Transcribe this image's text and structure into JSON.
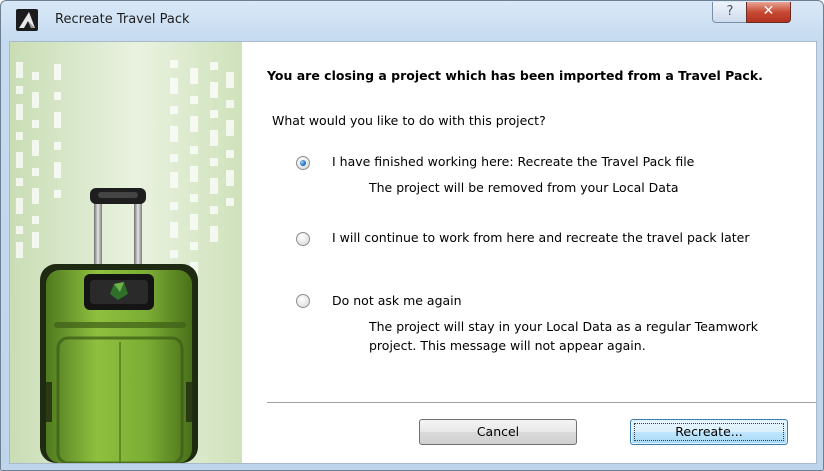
{
  "window": {
    "title": "Recreate Travel Pack",
    "app_icon": "archicad-app-icon",
    "help_button_label": "?",
    "close_button_label": "✕"
  },
  "dialog": {
    "heading": "You are closing a project which has been imported from a Travel Pack.",
    "question": "What would you like to do with this project?",
    "options": [
      {
        "label": "I have finished working here: Recreate the Travel Pack file",
        "description": [
          "The project will be removed from your Local Data"
        ],
        "selected": true
      },
      {
        "label": "I will continue to work from here and recreate the travel pack later",
        "description": [],
        "selected": false
      },
      {
        "label": "Do not ask me again",
        "description": [
          "The project will stay in your Local Data as a regular Teamwork",
          "project. This message will not appear again."
        ],
        "selected": false
      }
    ]
  },
  "buttons": {
    "cancel": "Cancel",
    "recreate": "Recreate..."
  },
  "colors": {
    "title_gradient": "#c6dbf0",
    "close_button": "#c84a33",
    "luggage_green": "#7fb03a",
    "hero_background": "#d7e8c8"
  }
}
